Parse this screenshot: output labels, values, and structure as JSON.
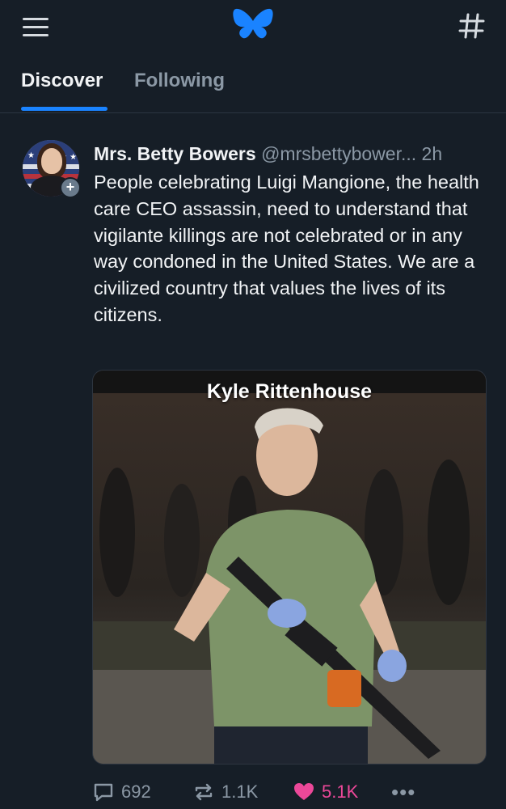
{
  "header": {
    "menu_icon": "hamburger-menu-icon",
    "logo_icon": "butterfly-logo-icon",
    "feeds_icon": "hashtag-icon",
    "accent_color": "#1a83ff"
  },
  "tabs": [
    {
      "label": "Discover",
      "active": true
    },
    {
      "label": "Following",
      "active": false
    }
  ],
  "post": {
    "author_name": "Mrs. Betty Bowers",
    "handle": "@mrsbettybower...",
    "timestamp": "2h",
    "text": "People celebrating Luigi Mangione, the health care CEO assassin, need to understand that vigilante killings are not celebrated or in any way condoned in the United States. We are a civilized country that values the lives of its citizens.",
    "follow_badge": "+",
    "media": {
      "caption": "Kyle Rittenhouse"
    },
    "actions": {
      "replies": "692",
      "reposts": "1.1K",
      "likes": "5.1K",
      "more": "•••",
      "like_color": "#ec4899"
    }
  }
}
